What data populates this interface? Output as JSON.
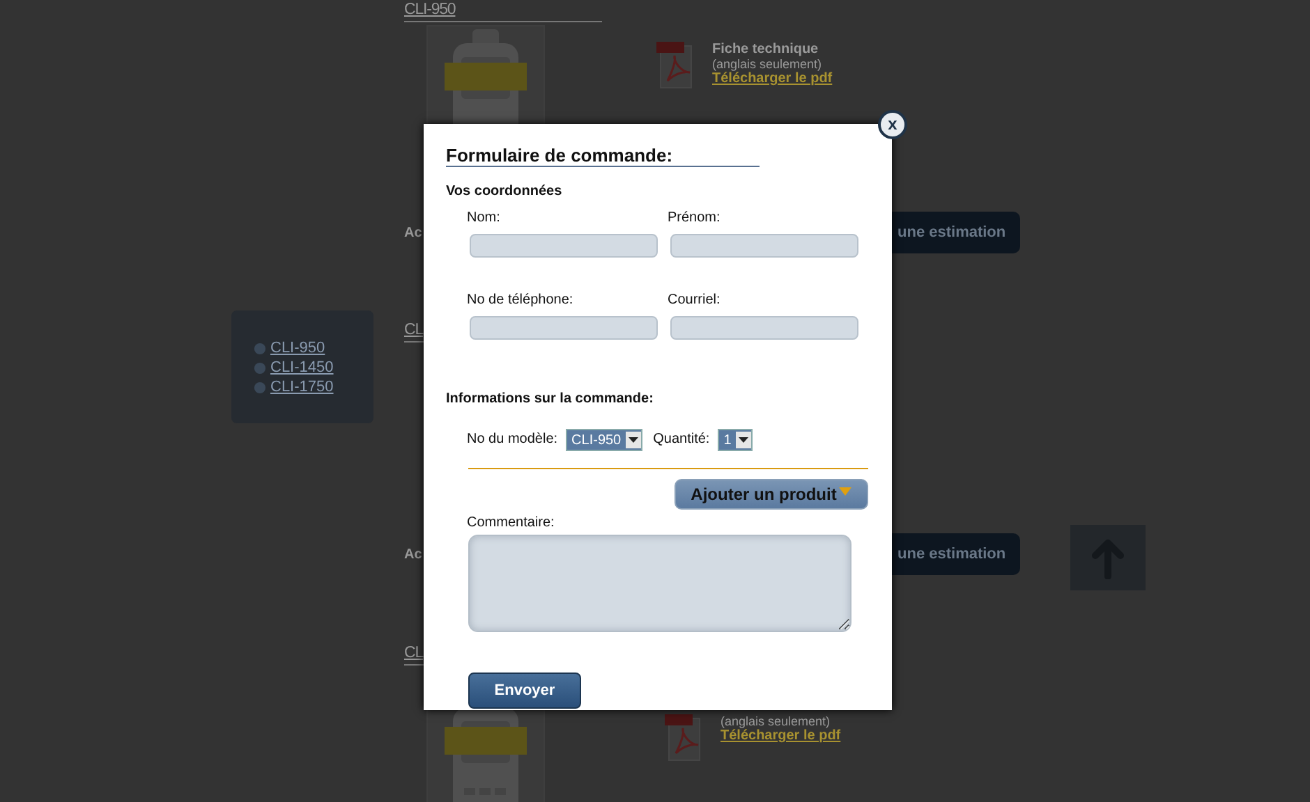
{
  "page": {
    "sections": [
      {
        "heading": "CLI-950",
        "datasheet": {
          "title": "Fiche technique",
          "note": "(anglais seulement)",
          "link": "Télécharger le pdf"
        },
        "action_label": "Ac",
        "action_button": "une estimation"
      },
      {
        "heading": "CL",
        "action_label": "Ac",
        "action_button": "une estimation"
      },
      {
        "heading": "CL",
        "datasheet": {
          "note": "(anglais seulement)",
          "link": "Télécharger le pdf"
        }
      }
    ],
    "sidebar": {
      "items": [
        "CLI-950",
        "CLI-1450",
        "CLI-1750"
      ]
    }
  },
  "modal": {
    "title": "Formulaire de commande:",
    "contact_heading": "Vos coordonnées",
    "fields": [
      {
        "label": "Nom:"
      },
      {
        "label": "Prénom:"
      },
      {
        "label": "No de téléphone:"
      },
      {
        "label": "Courriel:"
      }
    ],
    "order_heading": "Informations sur la commande:",
    "model": {
      "label": "No du modèle:",
      "value": "CLI-950"
    },
    "quantity": {
      "label": "Quantité:",
      "value": "1"
    },
    "add_button": "Ajouter un produit",
    "comment": {
      "label": "Commentaire:"
    },
    "submit_button": "Envoyer",
    "close_button": "x"
  }
}
